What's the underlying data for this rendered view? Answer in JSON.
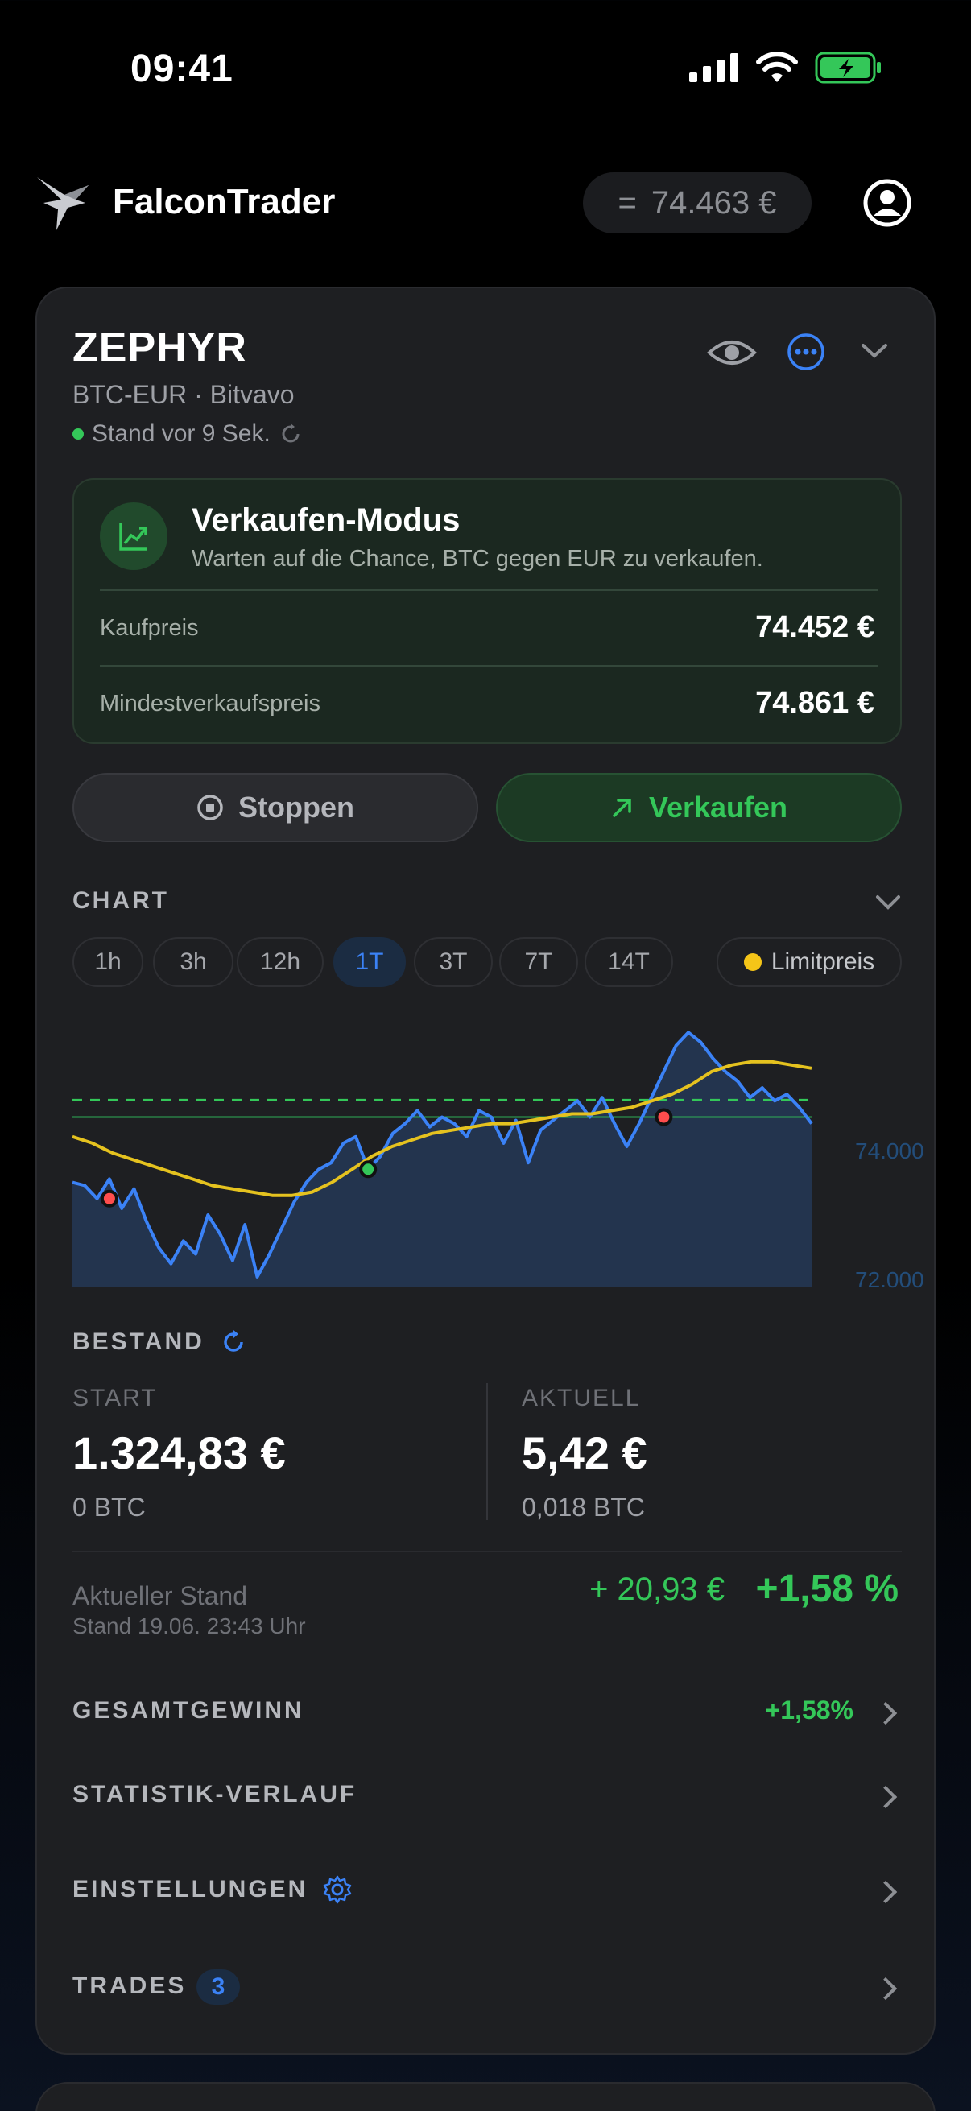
{
  "status_bar": {
    "time": "09:41"
  },
  "header": {
    "app_name": "FalconTrader",
    "balance_prefix": "=",
    "balance": "74.463 €"
  },
  "bot": {
    "name": "ZEPHYR",
    "pair": "BTC-EUR · Bitvavo",
    "status": "Stand vor 9 Sek."
  },
  "mode": {
    "title": "Verkaufen-Modus",
    "subtitle": "Warten auf die Chance, BTC gegen EUR zu verkaufen.",
    "buy_price_label": "Kaufpreis",
    "buy_price_value": "74.452 €",
    "min_sell_label": "Mindestverkaufspreis",
    "min_sell_value": "74.861 €"
  },
  "actions": {
    "stop_label": "Stoppen",
    "sell_label": "Verkaufen"
  },
  "chart_section": {
    "title": "CHART",
    "ranges": [
      "1h",
      "3h",
      "12h",
      "1T",
      "3T",
      "7T",
      "14T"
    ],
    "active_range": "1T",
    "limit_label": "Limitpreis"
  },
  "chart_data": {
    "type": "line",
    "yticks": [
      "74.000",
      "72.000"
    ],
    "ylim": [
      72000,
      76200
    ],
    "series": [
      {
        "color": "#3b82f6",
        "values": [
          73600,
          73550,
          73350,
          73650,
          73200,
          73500,
          73000,
          72600,
          72350,
          72700,
          72500,
          73100,
          72800,
          72400,
          72950,
          72150,
          72500,
          72900,
          73300,
          73600,
          73800,
          73900,
          74200,
          74300,
          73800,
          74000,
          74350,
          74500,
          74700,
          74450,
          74600,
          74500,
          74300,
          74700,
          74600,
          74200,
          74550,
          73900,
          74400,
          74550,
          74700,
          74850,
          74600,
          74900,
          74500,
          74150,
          74500,
          74900,
          75300,
          75700,
          75900,
          75750,
          75500,
          75300,
          75150,
          74900,
          75050,
          74850,
          74950,
          74750,
          74500
        ]
      },
      {
        "color": "#e5c21f",
        "values": [
          74300,
          74200,
          74050,
          73950,
          73850,
          73750,
          73650,
          73550,
          73500,
          73450,
          73400,
          73400,
          73450,
          73600,
          73800,
          74000,
          74150,
          74250,
          74350,
          74400,
          74450,
          74500,
          74500,
          74550,
          74600,
          74650,
          74650,
          74700,
          74750,
          74850,
          74950,
          75100,
          75300,
          75400,
          75450,
          75450,
          75400,
          75350
        ]
      }
    ],
    "limit_line": 74600,
    "min_sell_line": 74861,
    "markers": [
      {
        "index": 3,
        "value": 73350,
        "type": "sell",
        "color": "#ff4d4d"
      },
      {
        "index": 24,
        "value": 73800,
        "type": "buy",
        "color": "#34c759"
      },
      {
        "index": 48,
        "value": 74600,
        "type": "sell",
        "color": "#ff4d4d"
      }
    ]
  },
  "holdings": {
    "title": "BESTAND",
    "start_label": "START",
    "start_value": "1.324,83 €",
    "start_btc": "0 BTC",
    "current_label": "AKTUELL",
    "current_value": "5,42 €",
    "current_btc": "0,018 BTC",
    "status_label": "Aktueller Stand",
    "status_date": "Stand 19.06. 23:43 Uhr",
    "gain_abs": "+ 20,93 €",
    "gain_pct": "+1,58 %"
  },
  "menu": {
    "total_gain_label": "GESAMTGEWINN",
    "total_gain_value": "+1,58%",
    "history_label": "STATISTIK-VERLAUF",
    "settings_label": "EINSTELLUNGEN",
    "trades_label": "TRADES",
    "trades_count": "3"
  },
  "icons": [
    "signal-icon",
    "wifi-icon",
    "battery-icon",
    "falcon-logo-icon",
    "account-icon",
    "eye-icon",
    "more-icon",
    "chevron-down-icon",
    "refresh-icon",
    "trend-up-icon",
    "stop-icon",
    "arrow-up-right-icon",
    "gear-icon",
    "chevron-right-icon"
  ]
}
